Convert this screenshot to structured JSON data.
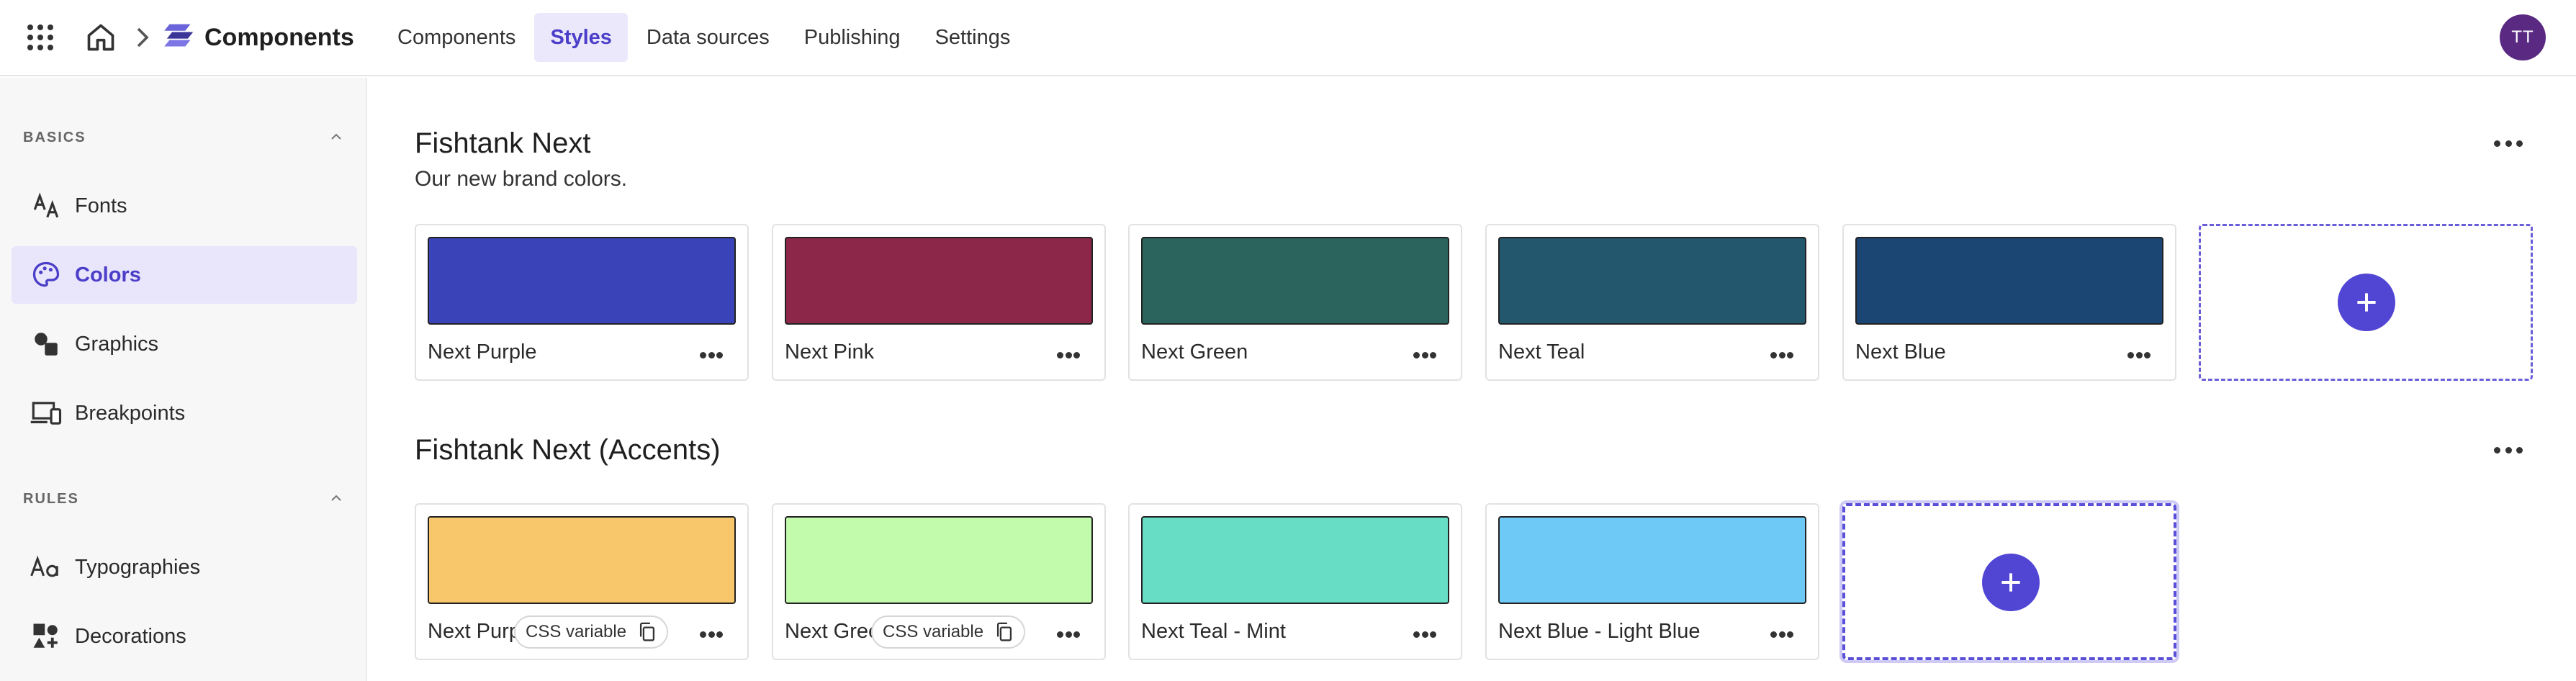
{
  "app": {
    "title": "Components"
  },
  "nav": {
    "tabs": [
      {
        "label": "Components",
        "active": false
      },
      {
        "label": "Styles",
        "active": true
      },
      {
        "label": "Data sources",
        "active": false
      },
      {
        "label": "Publishing",
        "active": false
      },
      {
        "label": "Settings",
        "active": false
      }
    ]
  },
  "user": {
    "initials": "TT"
  },
  "sidebar": {
    "sections": [
      {
        "title": "BASICS",
        "items": [
          {
            "label": "Fonts",
            "icon": "fonts-icon"
          },
          {
            "label": "Colors",
            "icon": "palette-icon",
            "active": true
          },
          {
            "label": "Graphics",
            "icon": "shapes-icon"
          },
          {
            "label": "Breakpoints",
            "icon": "devices-icon"
          }
        ]
      },
      {
        "title": "RULES",
        "items": [
          {
            "label": "Typographies",
            "icon": "typography-icon"
          },
          {
            "label": "Decorations",
            "icon": "decorations-icon"
          }
        ]
      }
    ]
  },
  "groups": [
    {
      "title": "Fishtank Next",
      "subtitle": "Our new brand colors.",
      "colors": [
        {
          "name": "Next Purple",
          "hex": "#3a44b8"
        },
        {
          "name": "Next Pink",
          "hex": "#8d2749"
        },
        {
          "name": "Next Green",
          "hex": "#2a645d"
        },
        {
          "name": "Next Teal",
          "hex": "#22576e"
        },
        {
          "name": "Next Blue",
          "hex": "#1b4674"
        }
      ]
    },
    {
      "title": "Fishtank Next (Accents)",
      "colors": [
        {
          "name": "Next Purple",
          "hex": "#f8c76b",
          "pill": "CSS variable"
        },
        {
          "name": "Next Green",
          "hex": "#c3fbac",
          "pill": "CSS variable"
        },
        {
          "name": "Next Teal - Mint",
          "hex": "#68ddc5"
        },
        {
          "name": "Next Blue - Light Blue",
          "hex": "#6ec9f6"
        }
      ]
    }
  ],
  "colors": {
    "accent": "#5146d4",
    "avatar": "#5a2a82"
  }
}
